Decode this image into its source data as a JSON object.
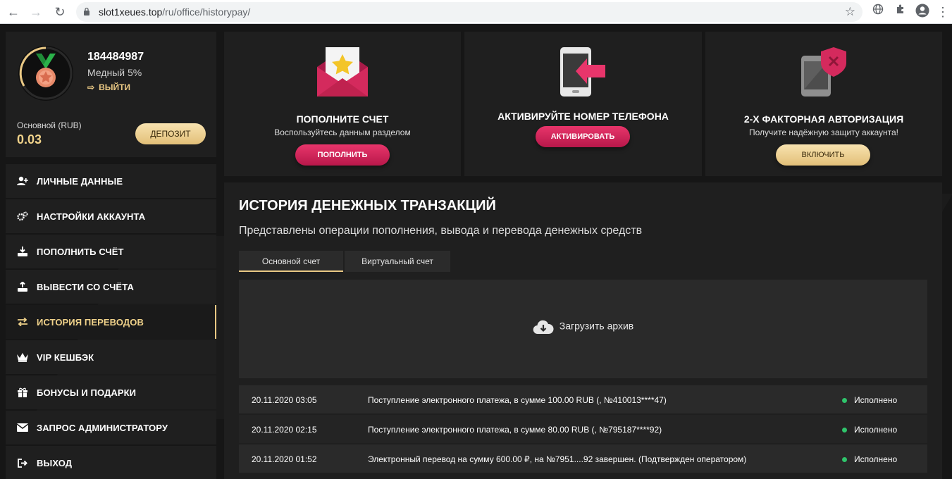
{
  "browser": {
    "url_host": "slot1xeues.top",
    "url_path": "/ru/office/historypay/"
  },
  "profile": {
    "user_id": "184484987",
    "level": "Медный 5%",
    "logout_label": "ВЫЙТИ",
    "balance_label": "Основной (RUB)",
    "balance_value": "0.03",
    "deposit_button": "ДЕПОЗИТ"
  },
  "menu": {
    "items": [
      {
        "label": "ЛИЧНЫЕ ДАННЫЕ",
        "icon": "user-plus-icon"
      },
      {
        "label": "НАСТРОЙКИ АККАУНТА",
        "icon": "gears-icon"
      },
      {
        "label": "ПОПОЛНИТЬ СЧЁТ",
        "icon": "download-icon"
      },
      {
        "label": "ВЫВЕСТИ СО СЧЁТА",
        "icon": "upload-icon"
      },
      {
        "label": "ИСТОРИЯ ПЕРЕВОДОВ",
        "icon": "exchange-icon",
        "active": true
      },
      {
        "label": "VIP КЕШБЭК",
        "icon": "crown-icon"
      },
      {
        "label": "БОНУСЫ И ПОДАРКИ",
        "icon": "gift-icon"
      },
      {
        "label": "ЗАПРОС АДМИНИСТРАТОРУ",
        "icon": "envelope-icon"
      },
      {
        "label": "ВЫХОД",
        "icon": "sign-out-icon"
      }
    ]
  },
  "cards": [
    {
      "title": "ПОПОЛНИТЕ СЧЕТ",
      "subtitle": "Воспользуйтесь данным разделом",
      "button": "ПОПОЛНИТЬ",
      "icon": "envelope-star-icon"
    },
    {
      "title": "АКТИВИРУЙТЕ НОМЕР ТЕЛЕФОНА",
      "subtitle": "",
      "button": "АКТИВИРОВАТЬ",
      "icon": "phone-arrow-icon"
    },
    {
      "title": "2-Х ФАКТОРНАЯ АВТОРИЗАЦИЯ",
      "subtitle": "Получите надёжную защиту аккаунта!",
      "button": "ВКЛЮЧИТЬ",
      "icon": "phone-shield-icon"
    }
  ],
  "history": {
    "title": "ИСТОРИЯ ДЕНЕЖНЫХ ТРАНЗАКЦИЙ",
    "subtitle": "Представлены операции пополнения, вывода и перевода денежных средств",
    "tabs": [
      "Основной счет",
      "Виртуальный счет"
    ],
    "archive_label": "Загрузить архив",
    "rows": [
      {
        "date": "20.11.2020 03:05",
        "description": "Поступление электронного платежа, в сумме 100.00 RUB (, №410013****47)",
        "status": "Исполнено"
      },
      {
        "date": "20.11.2020 02:15",
        "description": "Поступление электронного платежа, в сумме 80.00 RUB (, №795187****92)",
        "status": "Исполнено"
      },
      {
        "date": "20.11.2020 01:52",
        "description": "Электронный перевод на сумму 600.00 ₽, на №7951....92 завершен. (Подтвержден оператором)",
        "status": "Исполнено"
      }
    ]
  },
  "colors": {
    "accent_gold": "#e9c884",
    "accent_pink": "#d42a5d",
    "status_green": "#2fc46b"
  }
}
